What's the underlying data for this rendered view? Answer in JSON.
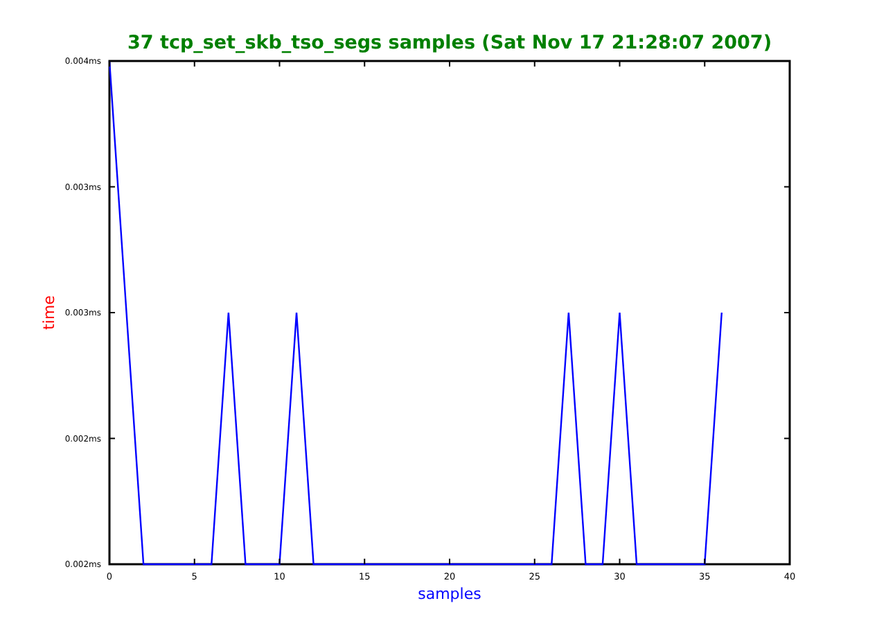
{
  "chart": {
    "chart_data": {
      "type": "line",
      "title": "37 tcp_set_skb_tso_segs samples (Sat Nov 17 21:28:07 2007)",
      "xlabel": "samples",
      "ylabel": "time",
      "x": [
        0,
        1,
        2,
        3,
        4,
        5,
        6,
        7,
        8,
        9,
        10,
        11,
        12,
        13,
        14,
        15,
        16,
        17,
        18,
        19,
        20,
        21,
        22,
        23,
        24,
        25,
        26,
        27,
        28,
        29,
        30,
        31,
        32,
        33,
        34,
        35,
        36
      ],
      "series": [
        {
          "color": "#0000ff",
          "values": [
            0.004,
            0.003,
            0.002,
            0.002,
            0.002,
            0.002,
            0.002,
            0.003,
            0.002,
            0.002,
            0.002,
            0.003,
            0.002,
            0.002,
            0.002,
            0.002,
            0.002,
            0.002,
            0.002,
            0.002,
            0.002,
            0.002,
            0.002,
            0.002,
            0.002,
            0.002,
            0.002,
            0.003,
            0.002,
            0.002,
            0.003,
            0.002,
            0.002,
            0.002,
            0.002,
            0.002,
            0.003
          ]
        }
      ],
      "xlim": [
        0,
        40
      ],
      "ylim": [
        0.002,
        0.004
      ],
      "xticks": [
        0,
        5,
        10,
        15,
        20,
        25,
        30,
        35,
        40
      ],
      "yticks": [
        {
          "value": 0.002,
          "label": "0.002ms"
        },
        {
          "value": 0.0025,
          "label": "0.002ms"
        },
        {
          "value": 0.003,
          "label": "0.003ms"
        },
        {
          "value": 0.0035,
          "label": "0.003ms"
        },
        {
          "value": 0.004,
          "label": "0.004ms"
        }
      ]
    }
  }
}
